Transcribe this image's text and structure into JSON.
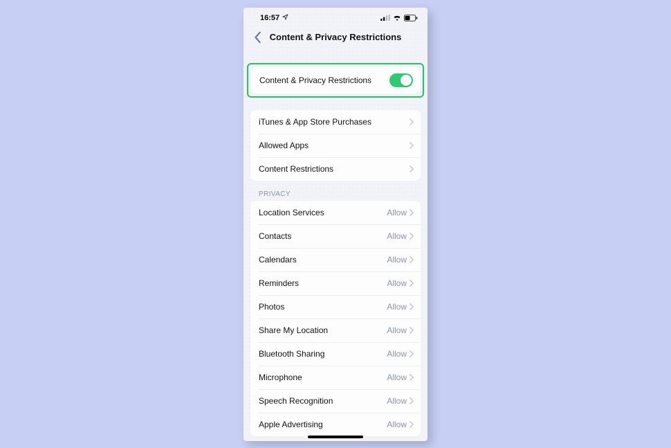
{
  "status": {
    "time": "16:57"
  },
  "nav": {
    "title": "Content & Privacy Restrictions"
  },
  "master_toggle": {
    "label": "Content & Privacy Restrictions"
  },
  "group1": {
    "items": [
      {
        "label": "iTunes & App Store Purchases"
      },
      {
        "label": "Allowed Apps"
      },
      {
        "label": "Content Restrictions"
      }
    ]
  },
  "privacy": {
    "header": "PRIVACY",
    "allow": "Allow",
    "items": [
      {
        "label": "Location Services"
      },
      {
        "label": "Contacts"
      },
      {
        "label": "Calendars"
      },
      {
        "label": "Reminders"
      },
      {
        "label": "Photos"
      },
      {
        "label": "Share My Location"
      },
      {
        "label": "Bluetooth Sharing"
      },
      {
        "label": "Microphone"
      },
      {
        "label": "Speech Recognition"
      },
      {
        "label": "Apple Advertising"
      }
    ]
  }
}
